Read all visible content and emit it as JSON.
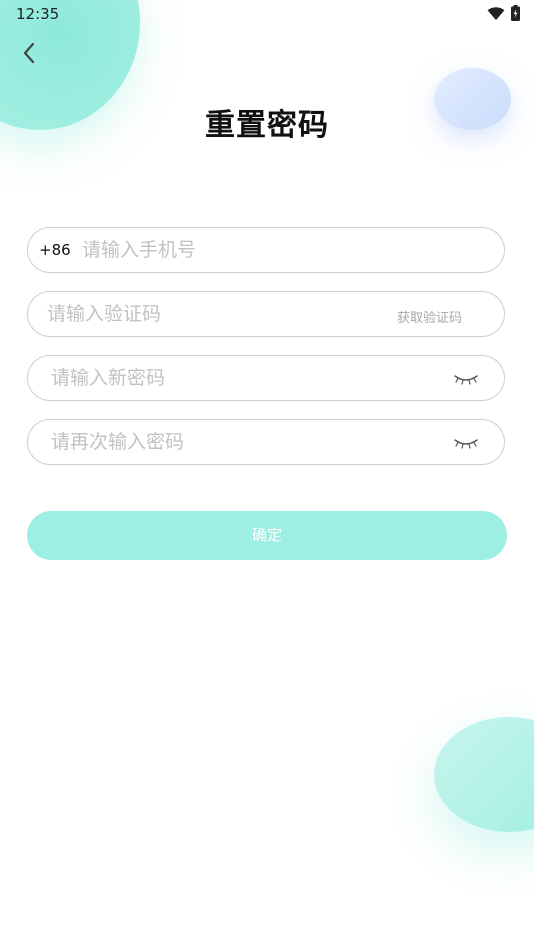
{
  "status_bar": {
    "time": "12:35",
    "icons": [
      "wifi-icon",
      "battery-icon"
    ]
  },
  "header": {
    "back_icon": "chevron-left-icon",
    "title": "重置密码"
  },
  "form": {
    "phone": {
      "prefix": "+86",
      "placeholder": "请输入手机号",
      "value": ""
    },
    "verification_code": {
      "placeholder": "请输入验证码",
      "value": "",
      "get_code_label": "获取验证码"
    },
    "new_password": {
      "placeholder": "请输入新密码",
      "value": "",
      "toggle_icon": "eye-closed-icon"
    },
    "confirm_password": {
      "placeholder": "请再次输入密码",
      "value": "",
      "toggle_icon": "eye-closed-icon"
    },
    "submit_label": "确定"
  },
  "colors": {
    "accent": "#9deee3",
    "border": "#cfcfcf",
    "placeholder": "#c2c2c2"
  }
}
